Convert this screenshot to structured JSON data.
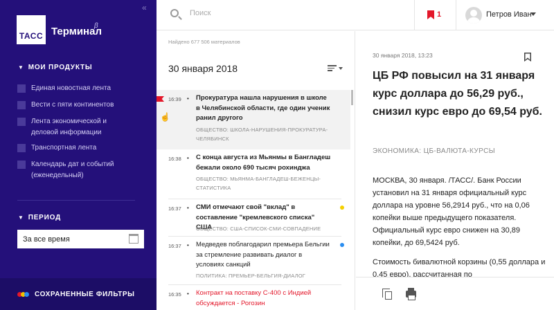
{
  "sidebar": {
    "collapse_glyph": "«",
    "logo_text": "ТАСС",
    "brand": "Терминал",
    "beta_mark": "β",
    "products_heading": "МОИ ПРОДУКТЫ",
    "products": [
      {
        "label": "Единая новостная лента"
      },
      {
        "label": "Вести с пяти континентов"
      },
      {
        "label": "Лента экономической и деловой информации"
      },
      {
        "label": "Транспортная лента"
      },
      {
        "label": "Календарь дат и событий (еженедельный)"
      }
    ],
    "period_heading": "ПЕРИОД",
    "period_value": "За все время",
    "saved_filters": "СОХРАНЕННЫЕ ФИЛЬТРЫ",
    "saved_dots_colors": [
      "#e3172a",
      "#f0c000",
      "#2a8ef0"
    ]
  },
  "topbar": {
    "search_placeholder": "Поиск",
    "bookmark_count": "1",
    "user_name": "Петров Иван"
  },
  "list": {
    "found": "Найдено 677 506 материалов",
    "date": "30 января 2018",
    "items": [
      {
        "time": "16:39",
        "title": "Прокуратура нашла нарушения в школе в Челябинской области, где один ученик ранил другого",
        "tags": "ОБЩЕСТВО: ШКОЛА-НАРУШЕНИЯ-ПРОКУРАТУРА-ЧЕЛЯБИНСК",
        "flagged": true,
        "dot_color": null
      },
      {
        "time": "16:38",
        "title": "С конца августа из Мьянмы в Бангладеш бежали около 690 тысяч рохинджа",
        "tags": "ОБЩЕСТВО: МЬЯНМА-БАНГЛАДЕШ-БЕЖЕНЦЫ-СТАТИСТИКА",
        "flagged": false,
        "dot_color": null
      },
      {
        "time": "16:37",
        "title": "СМИ отмечают свой \"вклад\" в составление \"кремлевского списка\" США",
        "tags": "ОБЩЕСТВО: США-СПИСОК-СМИ-СОВПАДЕНИЕ",
        "flagged": false,
        "dot_color": "#f5d000"
      },
      {
        "time": "16:37",
        "title": "Медведев поблагодарил премьера Бельгии за стремление развивать диалог в условиях санкций",
        "tags": "ПОЛИТИКА: ПРЕМЬЕР-БЕЛЬГИЯ-ДИАЛОГ",
        "flagged": false,
        "dot_color": "#2a8ef0"
      },
      {
        "time": "16:35",
        "title": "Контракт на поставку С-400 с Индией обсуждается - Рогозин",
        "tags": "",
        "flagged": false,
        "dot_color": null
      }
    ]
  },
  "article": {
    "datetime": "30 января 2018, 13:23",
    "title": "ЦБ РФ повысил на 31 января курс доллара до 56,29 руб., снизил курс евро до 69,54 руб.",
    "tags": "ЭКОНОМИКА: ЦБ-ВАЛЮТА-КУРСЫ",
    "paragraphs": [
      "МОСКВА, 30 января. /ТАСС/. Банк России установил на 31 января официальный курс доллара на уровне 56,2914 руб., что на 0,06 копейки выше предыдущего показателя. Официальный курс евро снижен на 30,89 копейки, до 69,5424 руб.",
      "Стоимость бивалютной корзины (0,55 доллара и 0,45 евро), рассчитанная по"
    ]
  }
}
